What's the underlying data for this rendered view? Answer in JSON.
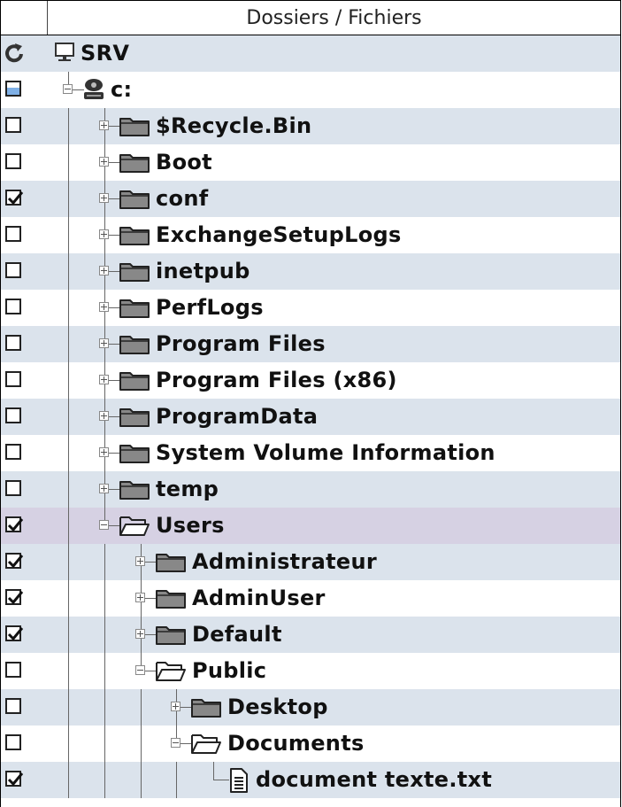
{
  "header": {
    "title": "Dossiers / Fichiers"
  },
  "tree": [
    {
      "label": "SRV",
      "depth": 0,
      "kind": "computer",
      "check": "refresh",
      "expander": "none",
      "highlight": "alt"
    },
    {
      "label": "c:",
      "depth": 1,
      "kind": "drive",
      "check": "partial",
      "expander": "minus",
      "highlight": "none"
    },
    {
      "label": "$Recycle.Bin",
      "depth": 2,
      "kind": "folder",
      "check": "unchecked",
      "expander": "plus",
      "highlight": "alt"
    },
    {
      "label": "Boot",
      "depth": 2,
      "kind": "folder",
      "check": "unchecked",
      "expander": "plus",
      "highlight": "none"
    },
    {
      "label": "conf",
      "depth": 2,
      "kind": "folder",
      "check": "checked",
      "expander": "plus",
      "highlight": "alt"
    },
    {
      "label": "ExchangeSetupLogs",
      "depth": 2,
      "kind": "folder",
      "check": "unchecked",
      "expander": "plus",
      "highlight": "none"
    },
    {
      "label": "inetpub",
      "depth": 2,
      "kind": "folder",
      "check": "unchecked",
      "expander": "plus",
      "highlight": "alt"
    },
    {
      "label": "PerfLogs",
      "depth": 2,
      "kind": "folder",
      "check": "unchecked",
      "expander": "plus",
      "highlight": "none"
    },
    {
      "label": "Program Files",
      "depth": 2,
      "kind": "folder",
      "check": "unchecked",
      "expander": "plus",
      "highlight": "alt"
    },
    {
      "label": "Program Files (x86)",
      "depth": 2,
      "kind": "folder",
      "check": "unchecked",
      "expander": "plus",
      "highlight": "none"
    },
    {
      "label": "ProgramData",
      "depth": 2,
      "kind": "folder",
      "check": "unchecked",
      "expander": "plus",
      "highlight": "alt"
    },
    {
      "label": "System Volume Information",
      "depth": 2,
      "kind": "folder",
      "check": "unchecked",
      "expander": "plus",
      "highlight": "none"
    },
    {
      "label": "temp",
      "depth": 2,
      "kind": "folder",
      "check": "unchecked",
      "expander": "plus",
      "highlight": "alt"
    },
    {
      "label": "Users",
      "depth": 2,
      "kind": "folder-open",
      "check": "checked",
      "expander": "minus",
      "highlight": "selected"
    },
    {
      "label": "Administrateur",
      "depth": 3,
      "kind": "folder",
      "check": "checked",
      "expander": "plus",
      "highlight": "alt"
    },
    {
      "label": "AdminUser",
      "depth": 3,
      "kind": "folder",
      "check": "checked",
      "expander": "plus",
      "highlight": "none"
    },
    {
      "label": "Default",
      "depth": 3,
      "kind": "folder",
      "check": "checked",
      "expander": "plus",
      "highlight": "alt"
    },
    {
      "label": "Public",
      "depth": 3,
      "kind": "folder-open",
      "check": "unchecked",
      "expander": "minus",
      "highlight": "none"
    },
    {
      "label": "Desktop",
      "depth": 4,
      "kind": "folder",
      "check": "unchecked",
      "expander": "plus",
      "highlight": "alt"
    },
    {
      "label": "Documents",
      "depth": 4,
      "kind": "folder-open",
      "check": "unchecked",
      "expander": "minus",
      "highlight": "none"
    },
    {
      "label": "document texte.txt",
      "depth": 5,
      "kind": "file",
      "check": "checked",
      "expander": "none",
      "highlight": "alt"
    }
  ],
  "colors": {
    "alt_row": "#dbe3ec",
    "selected_row": "#d6d1e3",
    "partial_check": "#7fb0e6",
    "folder": "#888888"
  },
  "icons": {
    "refresh": "refresh-icon",
    "computer": "monitor-icon",
    "drive": "hard-drive-icon",
    "folder": "folder-icon",
    "folder-open": "folder-open-icon",
    "file": "text-file-icon"
  }
}
